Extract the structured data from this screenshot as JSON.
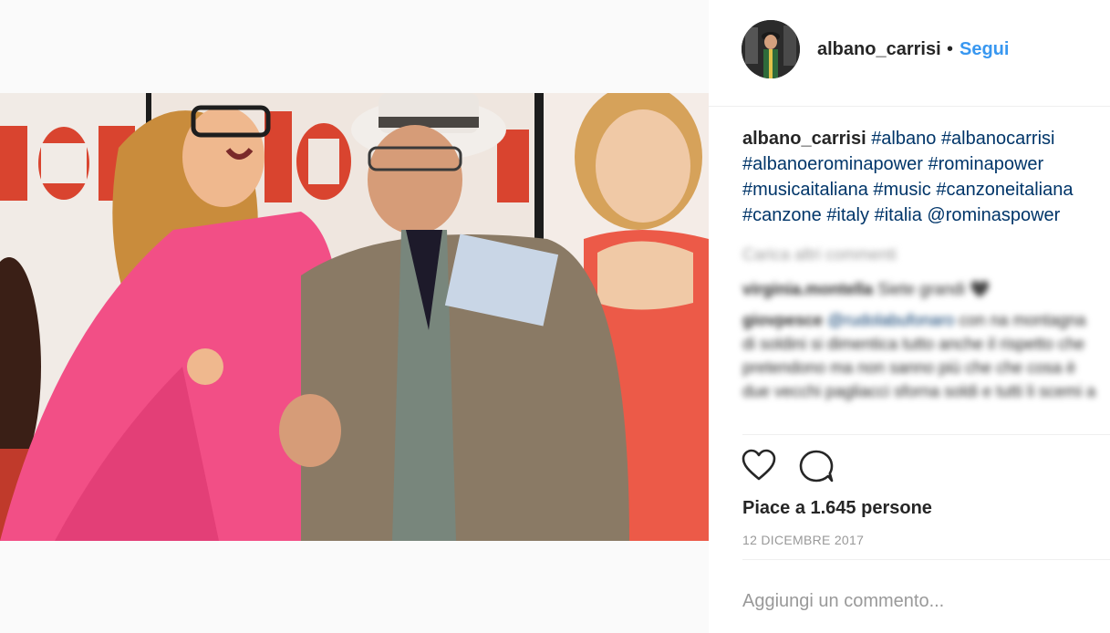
{
  "post": {
    "username": "albano_carrisi",
    "separator": "•",
    "follow_label": "Segui"
  },
  "caption": {
    "username": "albano_carrisi",
    "tags": [
      "#albano",
      "#albanocarrisi",
      "#albanoerominapower",
      "#rominapower",
      "#musicaitaliana",
      "#music",
      "#canzoneitaliana",
      "#canzone",
      "#italy",
      "#italia",
      "@rominaspower"
    ]
  },
  "comments": {
    "load_more": "Carica altri commenti",
    "items": [
      {
        "user": "virginia.montella",
        "text": "Siete grandi 🖤"
      },
      {
        "user": "giovpesce",
        "mention": "@rudolabufonaro",
        "text": "con na montagna di soldini si dimentica tutto anche il rispetto che pretendono ma non sanno più che che cosa è due vecchi pagliacci sforna soldi e tutti li scemi a"
      }
    ]
  },
  "actions": {
    "like_icon": "heart-outline-icon",
    "comment_icon": "speech-bubble-icon"
  },
  "likes_text": "Piace a 1.645 persone",
  "date": "12 DICEMBRE 2017",
  "add_comment": {
    "placeholder": "Aggiungi un commento..."
  },
  "colors": {
    "link_blue": "#3897f0",
    "hashtag_blue": "#003569",
    "muted": "#999999",
    "text": "#262626"
  }
}
